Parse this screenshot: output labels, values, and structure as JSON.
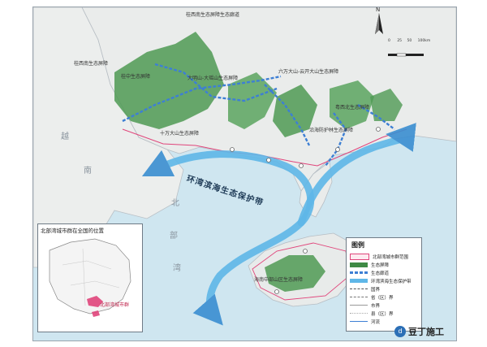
{
  "map": {
    "region_labels": {
      "viet": "越",
      "nam": "南",
      "bei": "北",
      "bu": "部",
      "wan": "湾"
    },
    "belt_label": "环湾滨海生态保护带",
    "callouts": [
      "桂西南生态屏障生态廊道",
      "桂西南生态屏障",
      "桂中生态屏障",
      "大明山-大瑶山生态屏障",
      "十万大山生态屏障",
      "六万大山-云开大山生态屏障",
      "粤西北生态屏障",
      "沿海防护林生态屏障",
      "海南中部山区生态屏障"
    ]
  },
  "inset": {
    "title": "北部湾城市群在全国的位置",
    "highlight_label": "北部湾城市群"
  },
  "legend": {
    "title": "图例",
    "items": [
      {
        "label": "北部湾城市群范围",
        "color": "#e0457b"
      },
      {
        "label": "生态屏障",
        "color": "#3f8a45"
      },
      {
        "label": "生态廊道",
        "color": "#3d7fd4"
      },
      {
        "label": "环湾滨海生态保护带",
        "color": "#5fb7e8"
      },
      {
        "label": "国界",
        "color": "#555555"
      },
      {
        "label": "省（区）界",
        "color": "#777777"
      },
      {
        "label": "市界",
        "color": "#999999"
      },
      {
        "label": "县（区）界",
        "color": "#aaaaaa"
      },
      {
        "label": "河流",
        "color": "#3d7fd4"
      }
    ]
  },
  "scale": {
    "labels": [
      "0",
      "25",
      "50",
      "100km"
    ]
  },
  "compass": {
    "north": "N"
  },
  "watermark": {
    "text": "豆丁施工",
    "logo": "d"
  }
}
